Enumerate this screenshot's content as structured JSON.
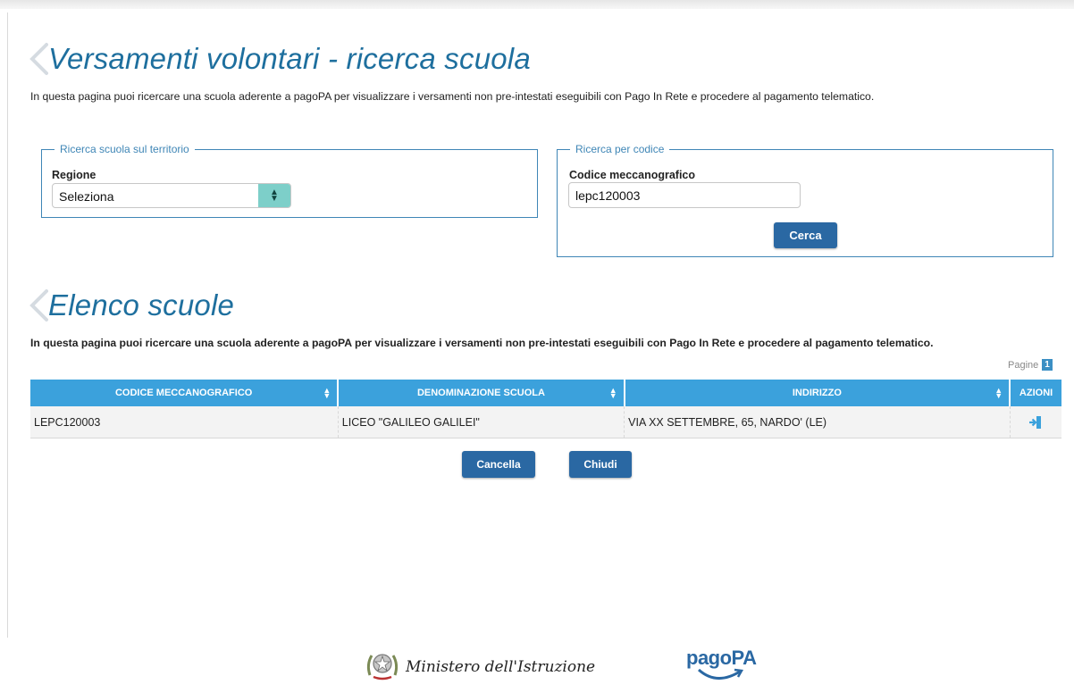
{
  "page": {
    "title": "Versamenti volontari - ricerca scuola",
    "intro": "In questa pagina puoi ricercare una scuola aderente a pagoPA per visualizzare i versamenti non pre-intestati eseguibili con Pago In Rete e procedere al pagamento telematico."
  },
  "territorio": {
    "legend": "Ricerca scuola sul territorio",
    "regione_label": "Regione",
    "regione_value": "Seleziona"
  },
  "codice": {
    "legend": "Ricerca per codice",
    "codice_label": "Codice meccanografico",
    "codice_value": "lepc120003",
    "search_button": "Cerca"
  },
  "results": {
    "title": "Elenco scuole",
    "intro": "In questa pagina puoi ricercare una scuola aderente a pagoPA per visualizzare i versamenti non pre-intestati eseguibili con Pago In Rete e procedere al pagamento telematico.",
    "pages_label": "Pagine",
    "current_page": "1",
    "columns": [
      "CODICE MECCANOGRAFICO",
      "DENOMINAZIONE SCUOLA",
      "INDIRIZZO",
      "AZIONI"
    ],
    "rows": [
      {
        "codice": "LEPC120003",
        "denominazione": "LICEO \"GALILEO GALILEI\"",
        "indirizzo": "VIA XX SETTEMBRE, 65, NARDO' (LE)",
        "azione_icon": "enter-icon"
      }
    ]
  },
  "buttons": {
    "cancel": "Cancella",
    "close": "Chiudi"
  },
  "footer": {
    "ministero": "Ministero dell'Istruzione",
    "pagopa": "pagoPA"
  },
  "colors": {
    "title_blue": "#1e6f9e",
    "header_blue": "#3ba1dc",
    "button_blue": "#2a68a3",
    "select_arrow": "#7dcfc9"
  }
}
